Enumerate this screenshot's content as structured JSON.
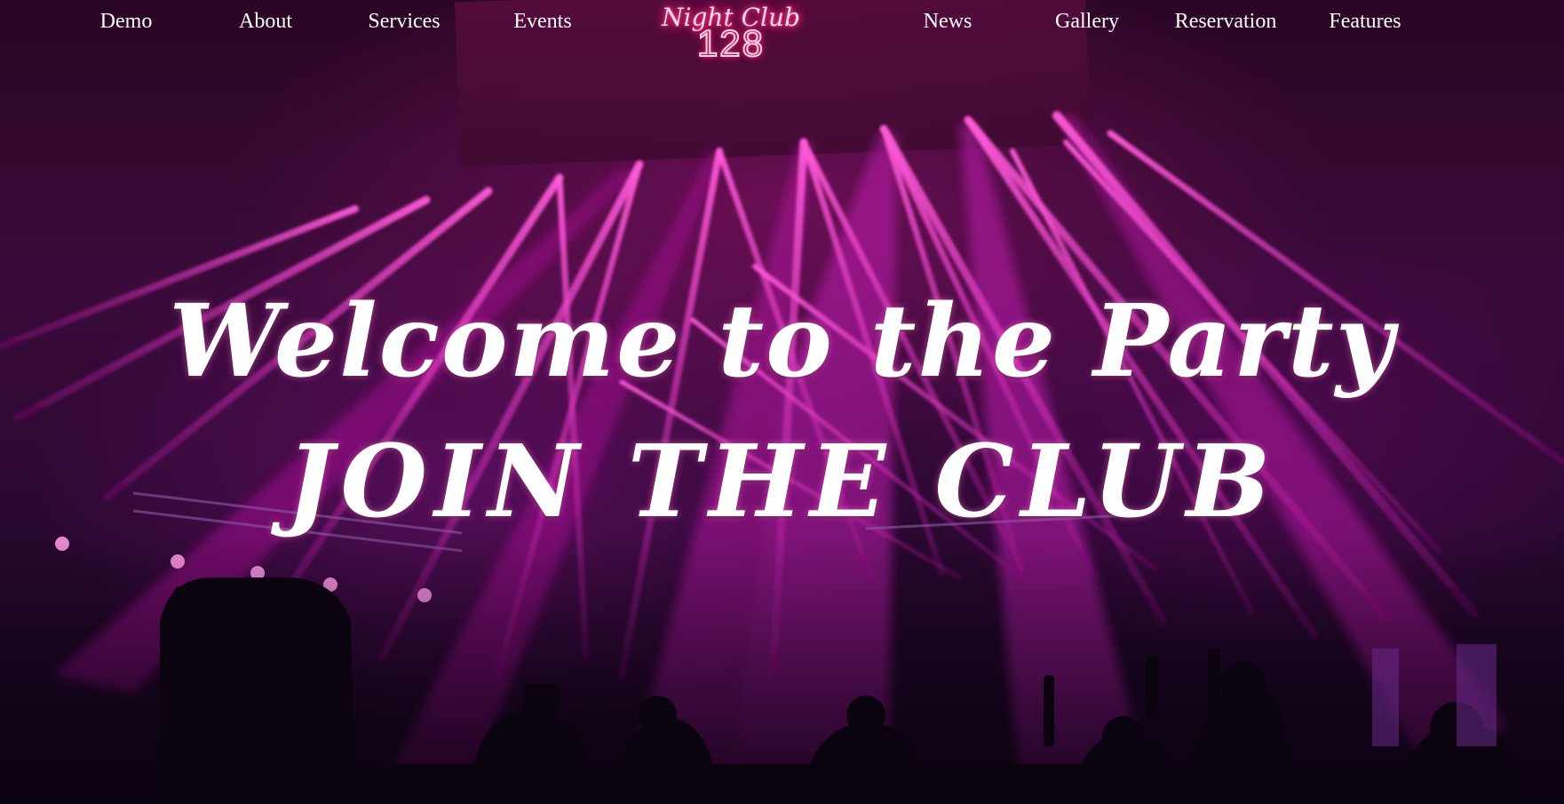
{
  "nav": {
    "items": [
      {
        "label": "Demo"
      },
      {
        "label": "About"
      },
      {
        "label": "Services"
      },
      {
        "label": "Events"
      },
      {
        "label": "News"
      },
      {
        "label": "Gallery"
      },
      {
        "label": "Reservation"
      },
      {
        "label": "Features"
      }
    ]
  },
  "logo": {
    "script_text": "Night Club",
    "number_text": "128",
    "glow_color": "#ff2f7a"
  },
  "hero": {
    "title": "Welcome to the Party",
    "subtitle": "JOIN THE CLUB",
    "accent_color": "#e020c0",
    "text_color": "#ffffff"
  }
}
